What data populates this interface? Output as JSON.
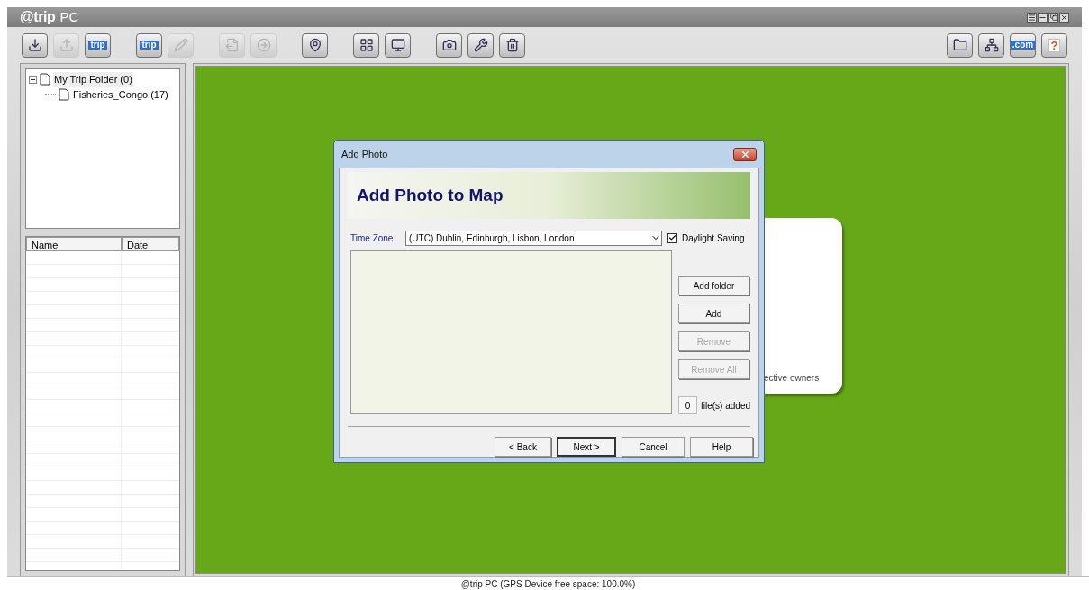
{
  "window": {
    "logo": "@trip",
    "title": "PC"
  },
  "toolbar": {
    "groups": [
      [
        {
          "kind": "import",
          "disabled": false
        },
        {
          "kind": "export",
          "disabled": true
        },
        {
          "kind": "label",
          "label": "trip",
          "disabled": false
        }
      ],
      [
        {
          "kind": "label",
          "label": "trip",
          "disabled": false
        },
        {
          "kind": "edit",
          "disabled": true
        }
      ],
      [
        {
          "kind": "file",
          "disabled": true
        },
        {
          "kind": "arrow",
          "disabled": true
        }
      ],
      [
        {
          "kind": "pin",
          "disabled": false
        }
      ],
      [
        {
          "kind": "grid",
          "disabled": false
        },
        {
          "kind": "screen",
          "disabled": false
        }
      ],
      [
        {
          "kind": "camera",
          "disabled": false
        },
        {
          "kind": "tool",
          "disabled": false
        },
        {
          "kind": "trash",
          "disabled": false
        }
      ]
    ],
    "right": [
      {
        "kind": "folder",
        "disabled": false
      },
      {
        "kind": "network",
        "disabled": false
      },
      {
        "kind": "label",
        "label": ".com",
        "disabled": false
      },
      {
        "kind": "label",
        "label": "?",
        "disabled": false
      }
    ]
  },
  "tree": [
    {
      "label": "My Trip Folder (0)",
      "expanded": true,
      "selected": true,
      "children": [
        {
          "label": "Fisheries_Congo (17)",
          "selected": false
        }
      ]
    }
  ],
  "list": {
    "columns": [
      "Name",
      "Date"
    ]
  },
  "card": {
    "text": "ective owners"
  },
  "dialog": {
    "title": "Add Photo",
    "heading": "Add Photo to Map",
    "time_zone_label": "Time Zone",
    "time_zone": "(UTC) Dublin, Edinburgh, Lisbon, London",
    "daylight": {
      "label": "Daylight Saving",
      "checked": true
    },
    "side_buttons": [
      {
        "label": "Add folder",
        "disabled": false
      },
      {
        "label": "Add",
        "disabled": false
      },
      {
        "label": "Remove",
        "disabled": true
      },
      {
        "label": "Remove All",
        "disabled": true
      }
    ],
    "count": "0",
    "count_label": "file(s) added",
    "buttons": [
      {
        "label": "< Back",
        "default": false
      },
      {
        "label": "Next >",
        "default": true
      },
      {
        "label": "Cancel",
        "default": false
      },
      {
        "label": "Help",
        "default": false
      }
    ]
  },
  "status_bar": "@trip PC (GPS Device free space: 100.0%)"
}
